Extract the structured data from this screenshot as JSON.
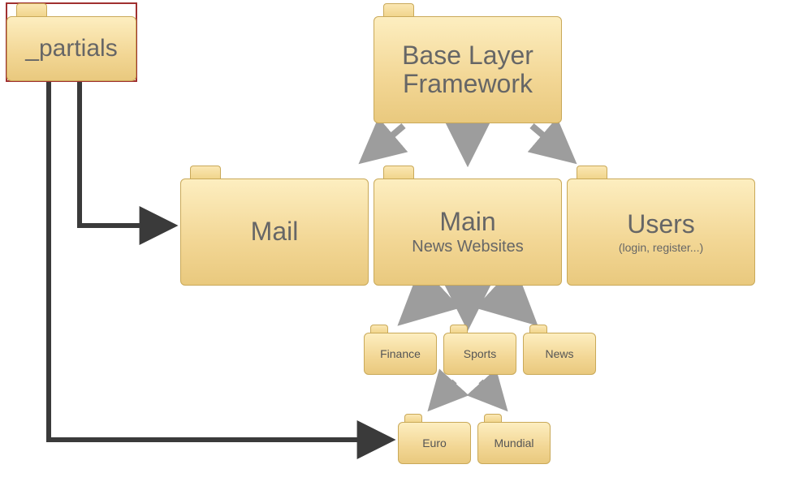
{
  "folders": {
    "partials": {
      "label": "_partials"
    },
    "base": {
      "line1": "Base Layer",
      "line2": "Framework"
    },
    "mail": {
      "label": "Mail"
    },
    "main": {
      "label": "Main",
      "sub": "News Websites"
    },
    "users": {
      "label": "Users",
      "sub": "(login, register...)"
    },
    "finance": {
      "label": "Finance"
    },
    "sports": {
      "label": "Sports"
    },
    "news": {
      "label": "News"
    },
    "euro": {
      "label": "Euro"
    },
    "mundial": {
      "label": "Mundial"
    }
  },
  "colors": {
    "arrow_gray": "#9d9d9d",
    "line_dark": "#3a3a3a"
  }
}
